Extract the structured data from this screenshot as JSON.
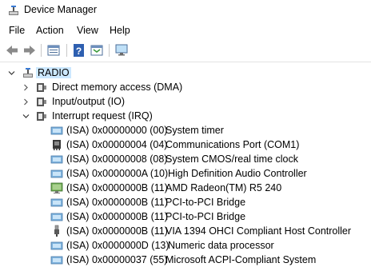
{
  "window": {
    "title": "Device Manager"
  },
  "menu": [
    {
      "label": "File"
    },
    {
      "label": "Action"
    },
    {
      "label": "View"
    },
    {
      "label": "Help"
    }
  ],
  "toolbar": {
    "buttons": [
      {
        "icon": "back-arrow-icon"
      },
      {
        "icon": "forward-arrow-icon"
      },
      {
        "icon": "properties-icon"
      },
      {
        "icon": "help-icon"
      },
      {
        "icon": "show-hide-icon"
      },
      {
        "icon": "monitor-icon"
      }
    ]
  },
  "tree": {
    "root": {
      "label": "RADIO",
      "expanded": true
    },
    "categories": [
      {
        "label": "Direct memory access (DMA)",
        "expanded": false
      },
      {
        "label": "Input/output (IO)",
        "expanded": false
      },
      {
        "label": "Interrupt request (IRQ)",
        "expanded": true
      }
    ],
    "irq_items": [
      {
        "id": "(ISA) 0x00000000 (00)",
        "name": "System timer",
        "icon": "system-device-icon"
      },
      {
        "id": "(ISA) 0x00000004 (04)",
        "name": "Communications Port (COM1)",
        "icon": "port-icon"
      },
      {
        "id": "(ISA) 0x00000008 (08)",
        "name": "System CMOS/real time clock",
        "icon": "system-device-icon"
      },
      {
        "id": "(ISA) 0x0000000A (10)",
        "name": "High Definition Audio Controller",
        "icon": "system-device-icon"
      },
      {
        "id": "(ISA) 0x0000000B (11)",
        "name": "AMD Radeon(TM) R5 240",
        "icon": "display-adapter-icon"
      },
      {
        "id": "(ISA) 0x0000000B (11)",
        "name": "PCI-to-PCI Bridge",
        "icon": "system-device-icon"
      },
      {
        "id": "(ISA) 0x0000000B (11)",
        "name": "PCI-to-PCI Bridge",
        "icon": "system-device-icon"
      },
      {
        "id": "(ISA) 0x0000000B (11)",
        "name": "VIA 1394 OHCI Compliant Host Controller",
        "icon": "usb-plug-icon"
      },
      {
        "id": "(ISA) 0x0000000D (13)",
        "name": "Numeric data processor",
        "icon": "system-device-icon"
      },
      {
        "id": "(ISA) 0x00000037 (55)",
        "name": "Microsoft ACPI-Compliant System",
        "icon": "system-device-icon"
      }
    ]
  }
}
